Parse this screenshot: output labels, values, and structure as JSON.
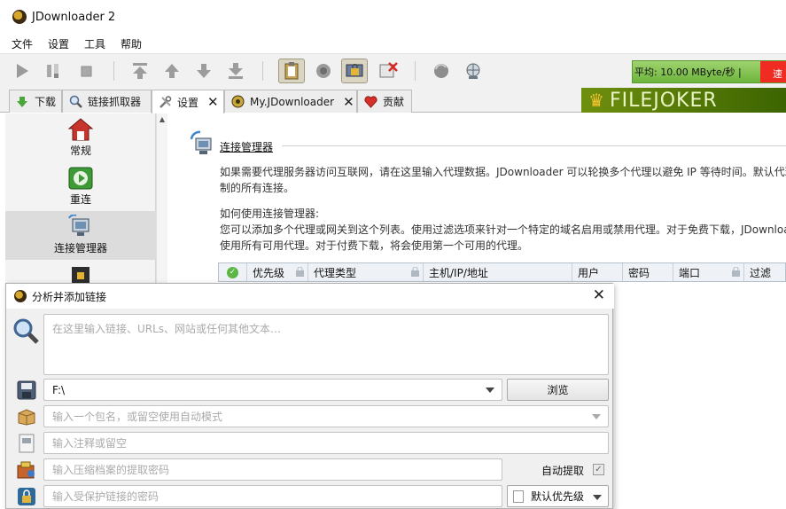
{
  "window": {
    "title": "JDownloader 2"
  },
  "menu": [
    "文件",
    "设置",
    "工具",
    "帮助"
  ],
  "toolbar": {
    "speed_text": "平均: 10.00 MByte/秒 |",
    "speed_overflow": "速"
  },
  "tabs": [
    {
      "label": "下载",
      "icon": "download-arrow-icon"
    },
    {
      "label": "链接抓取器",
      "icon": "magnifier-icon"
    },
    {
      "label": "设置",
      "icon": "tools-icon",
      "closable": true
    },
    {
      "label": "My.JDownloader",
      "icon": "globe-icon",
      "closable": true
    },
    {
      "label": "贡献",
      "icon": "heart-icon"
    }
  ],
  "banner": {
    "text": "FILEJOKER"
  },
  "sidebar": {
    "items": [
      {
        "label": "常规",
        "icon": "house-icon"
      },
      {
        "label": "重连",
        "icon": "reconnect-icon"
      },
      {
        "label": "连接管理器",
        "icon": "network-icon",
        "selected": true
      }
    ]
  },
  "content": {
    "title": "连接管理器",
    "para1_line1": "如果需要代理服务器访问互联网，请在这里输入代理数据。JDownloader 可以轮换多个代理以避免 IP 等待时间。默认代理",
    "para1_line2": "制的所有连接。",
    "para2_line1": "如何使用连接管理器:",
    "para2_line2": "您可以添加多个代理或网关到这个列表。使用过滤选项来针对一个特定的域名启用或禁用代理。对于免费下载，JDownloa",
    "para2_line3": "使用所有可用代理。对于付费下载，将会使用第一个可用的代理。",
    "columns": [
      "优先级",
      "代理类型",
      "主机/IP/地址",
      "用户",
      "密码",
      "端口",
      "过滤"
    ]
  },
  "dialog": {
    "title": "分析并添加链接",
    "links_placeholder": "在这里输入链接、URLs、网站或任何其他文本…",
    "folder_value": "F:\\",
    "browse_label": "浏览",
    "package_placeholder": "输入一个包名，或留空使用自动模式",
    "comment_placeholder": "输入注释或留空",
    "archive_password_placeholder": "输入压缩档案的提取密码",
    "auto_extract_label": "自动提取",
    "auto_extract_checked": true,
    "protected_password_placeholder": "输入受保护链接的密码",
    "priority_label": "默认优先级"
  }
}
